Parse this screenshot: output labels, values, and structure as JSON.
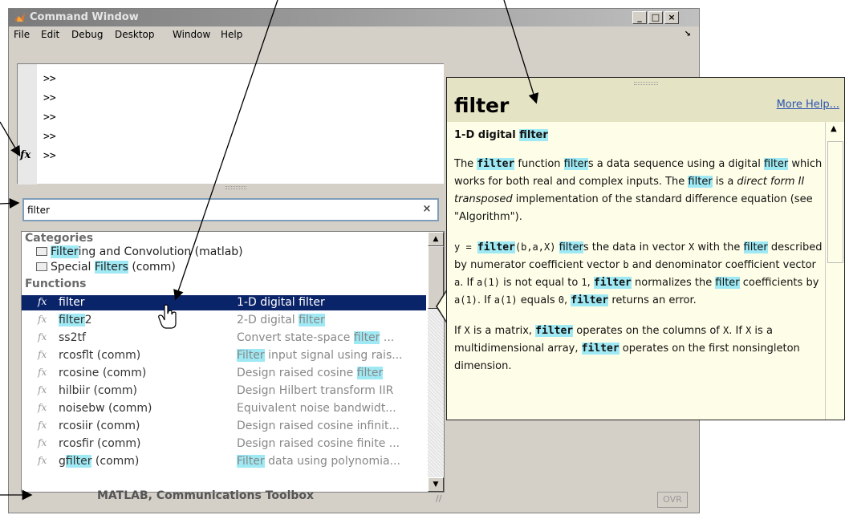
{
  "window": {
    "title": "Command Window",
    "controls": {
      "minimize": "_",
      "maximize": "□",
      "close": "×"
    }
  },
  "menu": [
    "File",
    "Edit",
    "Debug",
    "Desktop",
    "Window",
    "Help"
  ],
  "command": {
    "prompts": [
      ">>",
      ">>",
      ">>",
      ">>",
      ">>"
    ],
    "fx_label": "fx"
  },
  "search": {
    "value": "filter",
    "clear_label": "×"
  },
  "results": {
    "categories_header": "Categories",
    "categories": [
      {
        "pre": "",
        "hl": "Filter",
        "post": "ing and Convolution (matlab)"
      },
      {
        "pre": "Special ",
        "hl": "Filters",
        "post": " (comm)"
      }
    ],
    "functions_header": "Functions",
    "functions": [
      {
        "name_pre": "filter",
        "name_hl": "",
        "name_post": "",
        "desc_pre": "1-D digital filter",
        "desc_hl": "",
        "desc_post": "",
        "selected": true
      },
      {
        "name_pre": "",
        "name_hl": "filter",
        "name_post": "2",
        "desc_pre": "2-D digital ",
        "desc_hl": "filter",
        "desc_post": "",
        "selected": false
      },
      {
        "name_pre": "ss2tf",
        "name_hl": "",
        "name_post": "",
        "desc_pre": "Convert state-space ",
        "desc_hl": "filter",
        "desc_post": " ...",
        "selected": false
      },
      {
        "name_pre": "rcosflt (comm)",
        "name_hl": "",
        "name_post": "",
        "desc_pre": "",
        "desc_hl": "Filter",
        "desc_post": " input signal using rais...",
        "selected": false
      },
      {
        "name_pre": "rcosine (comm)",
        "name_hl": "",
        "name_post": "",
        "desc_pre": "Design raised cosine ",
        "desc_hl": "filter",
        "desc_post": "",
        "selected": false
      },
      {
        "name_pre": "hilbiir (comm)",
        "name_hl": "",
        "name_post": "",
        "desc_pre": "Design Hilbert transform IIR ",
        "desc_hl": " ",
        "desc_post": "",
        "selected": false
      },
      {
        "name_pre": "noisebw (comm)",
        "name_hl": "",
        "name_post": "",
        "desc_pre": "Equivalent noise bandwidt...",
        "desc_hl": "",
        "desc_post": "",
        "selected": false
      },
      {
        "name_pre": "rcosiir (comm)",
        "name_hl": "",
        "name_post": "",
        "desc_pre": "Design raised cosine infinit...",
        "desc_hl": "",
        "desc_post": "",
        "selected": false
      },
      {
        "name_pre": "rcosfir (comm)",
        "name_hl": "",
        "name_post": "",
        "desc_pre": "Design raised cosine finite ...",
        "desc_hl": "",
        "desc_post": "",
        "selected": false
      },
      {
        "name_pre": "g",
        "name_hl": "filter",
        "name_post": " (comm)",
        "desc_pre": "",
        "desc_hl": "Filter",
        "desc_post": " data using polynomia...",
        "selected": false
      }
    ]
  },
  "status": {
    "source": "MATLAB, Communications Toolbox",
    "ovr": "OVR"
  },
  "help": {
    "title": "filter",
    "more_help": "More Help...",
    "subtitle_pre": "1-D digital ",
    "subtitle_hl": "filter",
    "p1": {
      "a": "The ",
      "code1": "filter",
      "b": " function ",
      "hl1": "filter",
      "c": "s a data sequence using a digital ",
      "hl2": "filter",
      "d": " which works for both real and complex inputs. The ",
      "hl3": "filter",
      "e": " is a ",
      "em": "direct form II transposed",
      "f": " implementation of the standard difference equation (see \"Algorithm\")."
    },
    "p2": {
      "m1": "y = ",
      "code1": "filter",
      "m2": "(b,a,X)",
      "a": " ",
      "hl1": "filter",
      "b": "s the data in vector ",
      "m3": "X",
      "c": " with the ",
      "hl2": "filter",
      "d": " described by numerator coefficient vector ",
      "m4": "b",
      "e": " and denominator coefficient vector ",
      "m5": "a",
      "f": ". If ",
      "m6": "a(1)",
      "g": " is not equal to ",
      "m7": "1",
      "h": ", ",
      "code2": "filter",
      "i": " normalizes the ",
      "hl3": "filter",
      "j": " coefficients by ",
      "m8": "a(1)",
      "k": ". If ",
      "m9": "a(1)",
      "l": " equals ",
      "m10": "0",
      "m": ", ",
      "code3": "filter",
      "n": " returns an error."
    },
    "p3": {
      "a": "If ",
      "m1": "X",
      "b": " is a matrix, ",
      "code1": "filter",
      "c": " operates on the columns of ",
      "m2": "X",
      "d": ". If ",
      "m3": "X",
      "e": " is a multidimensional array, ",
      "code2": "filter",
      "f": " operates on the first nonsingleton dimension."
    }
  },
  "colors": {
    "highlight": "#9fe9f4",
    "selection": "#0a246a",
    "link": "#2b53b0",
    "popup_bg": "#fefee8"
  }
}
